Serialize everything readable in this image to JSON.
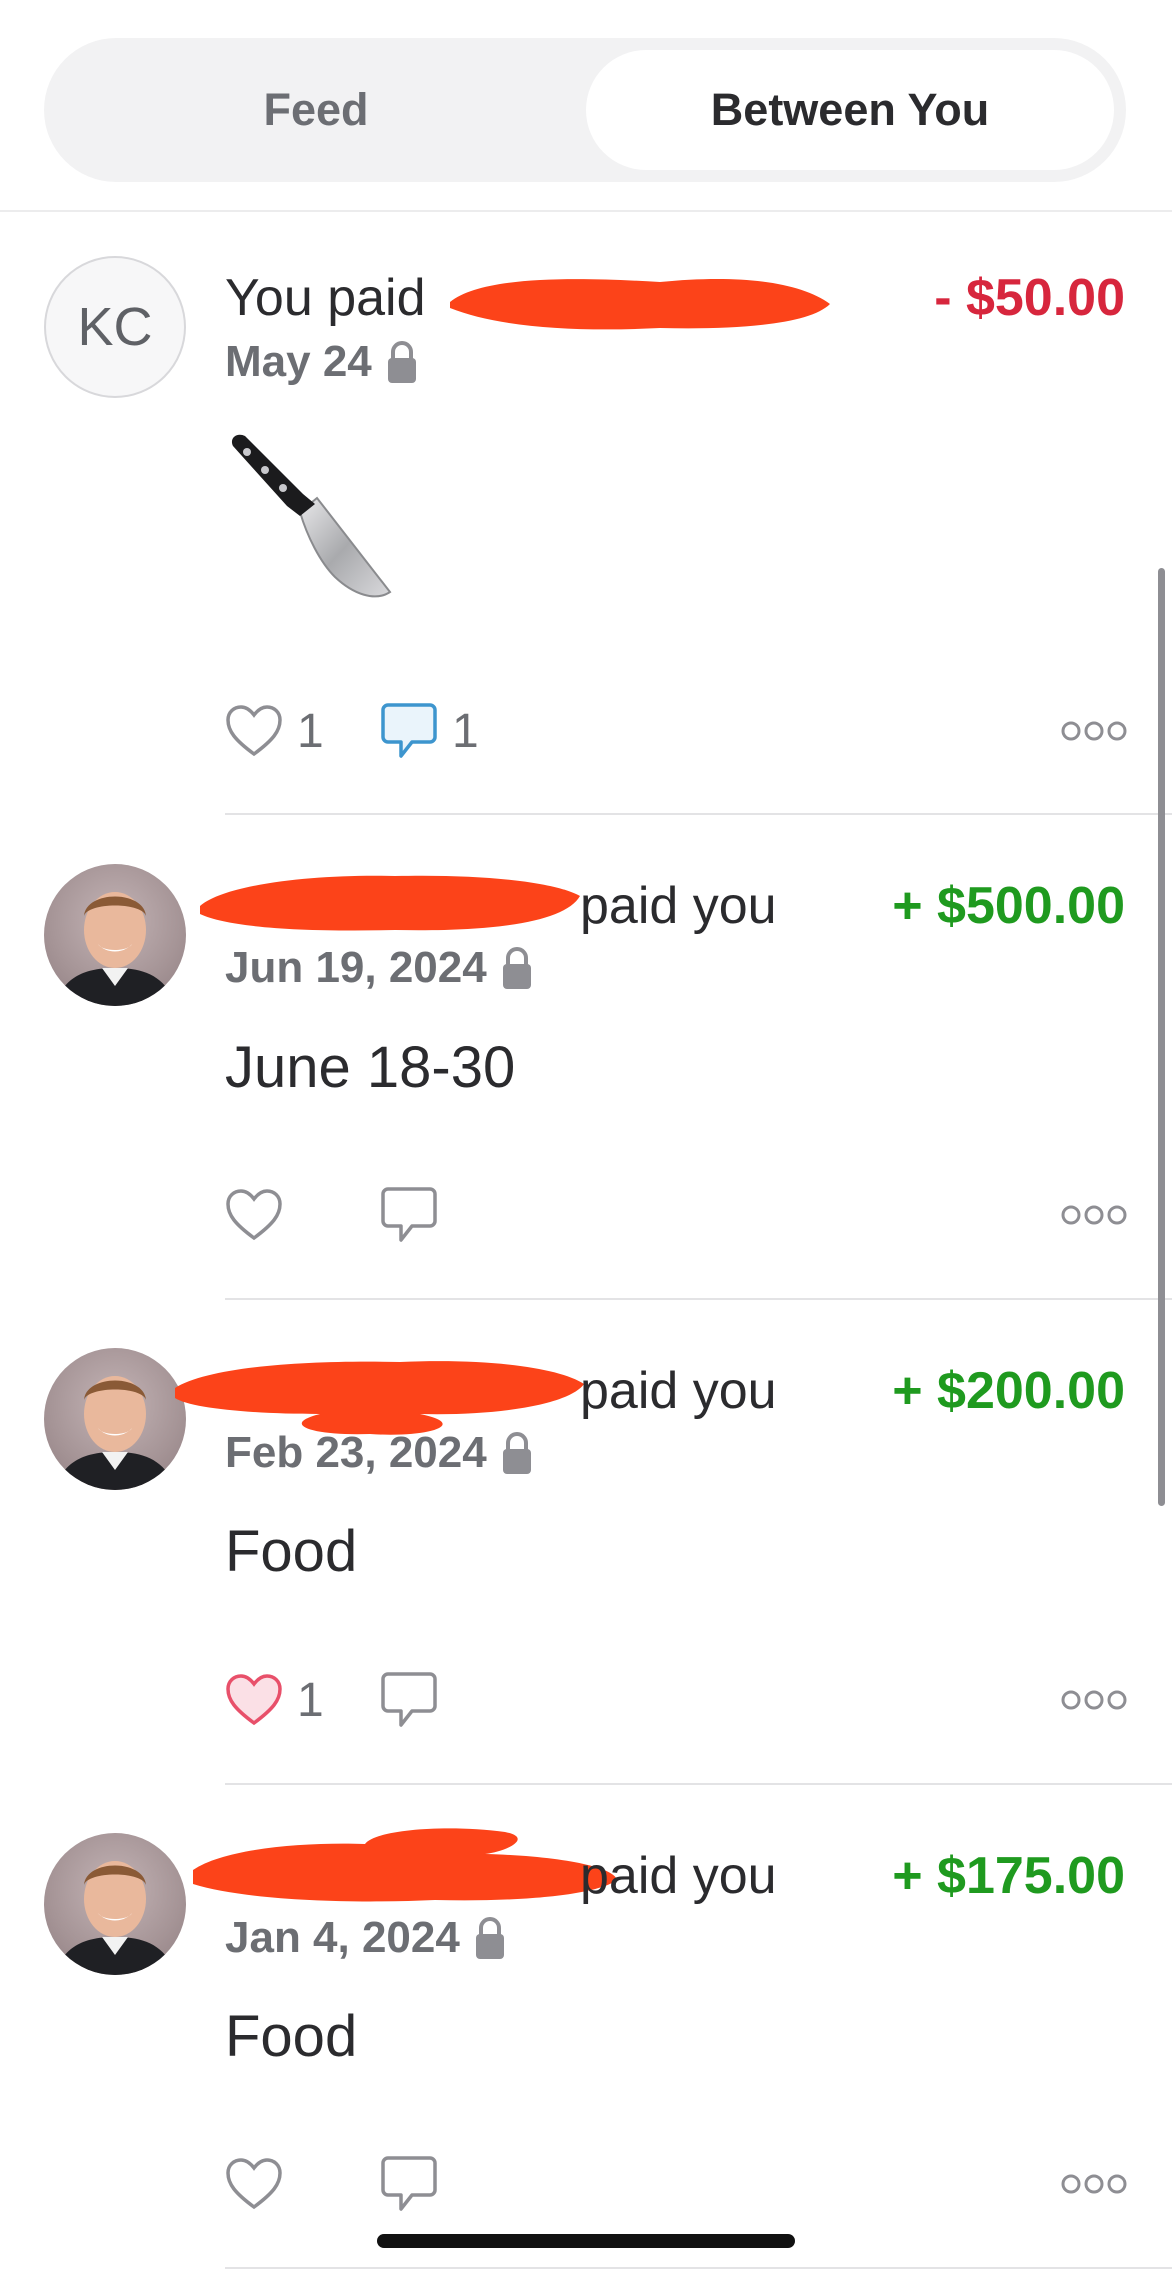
{
  "tabs": [
    {
      "label": "Feed",
      "selected": false
    },
    {
      "label": "Between You",
      "selected": true
    }
  ],
  "transactions": [
    {
      "avatar_initials": "KC",
      "title": "You paid",
      "amount": "- $50.00",
      "amount_color": "#d7263d",
      "date": "May 24",
      "note_emoji": "kitchen-knife",
      "likes": "1",
      "comments": "1",
      "liked": false
    },
    {
      "title": "paid you",
      "amount": "+ $500.00",
      "amount_color": "#1f9a1f",
      "date": "Jun 19, 2024",
      "note": "June 18-30",
      "likes": "",
      "comments": "",
      "liked": false
    },
    {
      "title": "paid you",
      "amount": "+ $200.00",
      "amount_color": "#1f9a1f",
      "date": "Feb 23, 2024",
      "note": "Food",
      "likes": "1",
      "comments": "",
      "liked": true
    },
    {
      "title": "paid you",
      "amount": "+ $175.00",
      "amount_color": "#1f9a1f",
      "date": "Jan 4, 2024",
      "note": "Food",
      "likes": "",
      "comments": "",
      "liked": false
    }
  ],
  "colors": {
    "redaction": "#fc4319",
    "negative": "#d7263d",
    "positive": "#1f9a1f",
    "comment_active": "#3d95ce",
    "like_active": "#e8506a"
  }
}
